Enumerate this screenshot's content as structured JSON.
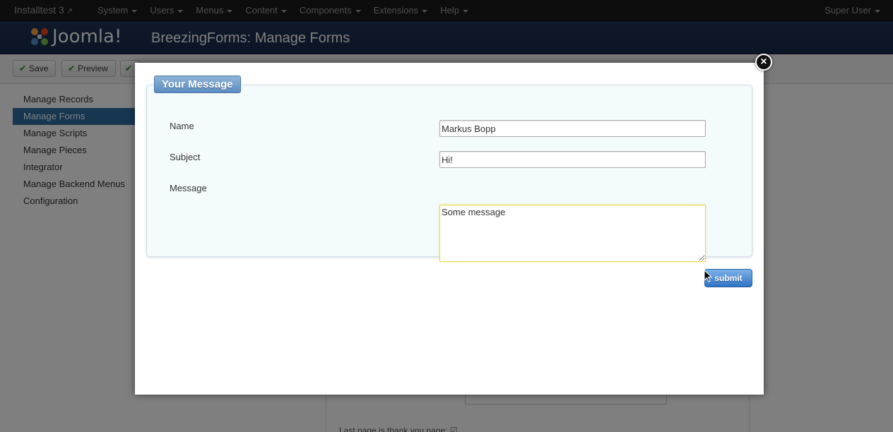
{
  "topbar": {
    "site_name": "Installtest 3",
    "external_icon": "external-link-icon",
    "menu": [
      "System",
      "Users",
      "Menus",
      "Content",
      "Components",
      "Extensions",
      "Help"
    ],
    "user": "Super User"
  },
  "header": {
    "logo_text": "Joomla!",
    "page_title": "BreezingForms: Manage Forms"
  },
  "toolbar": {
    "save_label": "Save",
    "preview_label": "Preview"
  },
  "sidebar": {
    "items": [
      {
        "label": "Manage Records",
        "active": false
      },
      {
        "label": "Manage Forms",
        "active": true
      },
      {
        "label": "Manage Scripts",
        "active": false
      },
      {
        "label": "Manage Pieces",
        "active": false
      },
      {
        "label": "Integrator",
        "active": false
      },
      {
        "label": "Manage Backend Menus",
        "active": false
      },
      {
        "label": "Configuration",
        "active": false
      }
    ]
  },
  "background": {
    "last_page_text": "Last page is thank you page:"
  },
  "modal": {
    "legend": "Your Message",
    "fields": {
      "name": {
        "label": "Name",
        "value": "Markus Bopp"
      },
      "subject": {
        "label": "Subject",
        "value": "Hi!"
      },
      "message": {
        "label": "Message",
        "value": "Some message"
      }
    },
    "submit_label": "submit",
    "close_glyph": "×"
  },
  "colors": {
    "topbar_bg": "#1b1b1b",
    "header_bg": "#1d3354",
    "sidebar_active": "#2d6ca2",
    "submit_button": "#2f73c4"
  }
}
